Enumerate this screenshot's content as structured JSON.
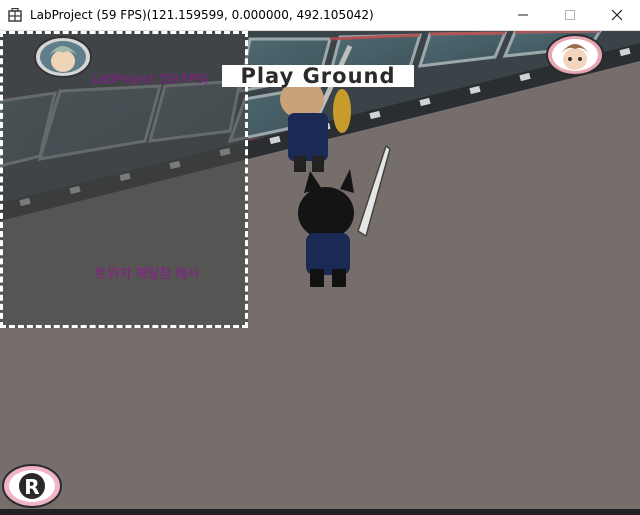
{
  "window": {
    "title": "LabProject (59 FPS)(121.159599, 0.000000, 492.105042)",
    "icon": "app-grid-icon",
    "controls": [
      "minimize-icon",
      "maximize-icon",
      "close-icon"
    ]
  },
  "hud": {
    "banner": "Play Ground",
    "chat_panel": {
      "fps_label": "LabProject (59 FPS)",
      "example_label": "트위치 채팅창 예시"
    },
    "player_left_avatar": "player-portrait-icon",
    "player_right_avatar": "player-portrait-icon",
    "record_button": "R"
  },
  "colors": {
    "ground": "#756e6b",
    "chat_text": "#8a1a90",
    "panel_border": "#ffffff"
  }
}
